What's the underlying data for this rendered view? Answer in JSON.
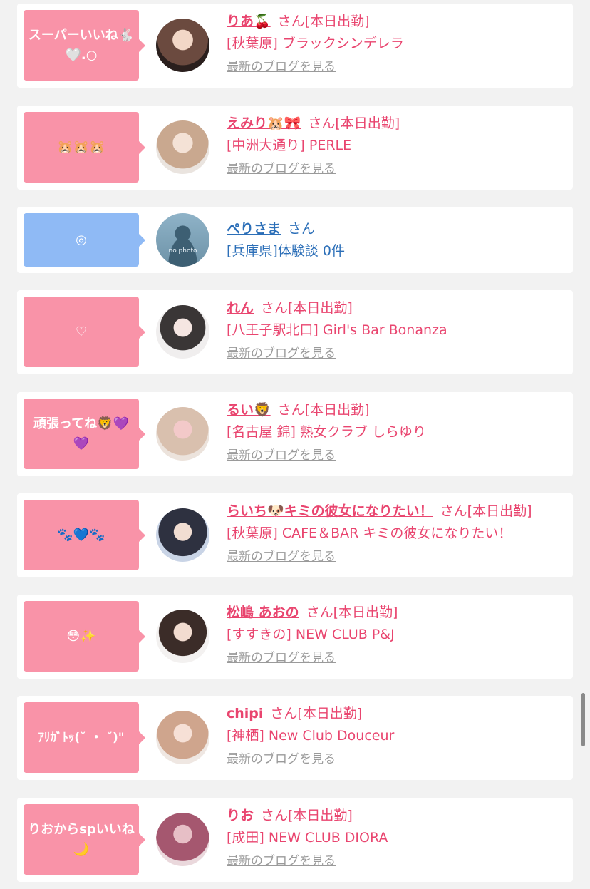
{
  "blog_link_label": "最新のブログを見る",
  "entries": [
    {
      "message": "スーパーいいね🐇🤍.○",
      "name": "りあ🍒",
      "suffix": "さん[本日出勤]",
      "shop": "[秋葉原] ブラックシンデレラ",
      "type": "pink",
      "avatar_color": "#6b4a3f"
    },
    {
      "message": "🐹🐹🐹",
      "name": "えみり🐹🎀",
      "suffix": "さん[本日出勤]",
      "shop": "[中洲大通り] PERLE",
      "type": "pink",
      "avatar_color": "#c9a88f"
    },
    {
      "message": "◎",
      "name": "ぺりさま",
      "suffix": "さん",
      "shop": "[兵庫県]体験談 0件",
      "type": "blue",
      "avatar_text": "no photo"
    },
    {
      "message": "♡",
      "name": "れん",
      "suffix": "さん[本日出勤]",
      "shop": "[八王子駅北口] Girl's Bar Bonanza",
      "type": "pink",
      "avatar_color": "#3a3636"
    },
    {
      "message": "頑張ってね🦁💜💜",
      "name": "るい🦁",
      "suffix": "さん[本日出勤]",
      "shop": "[名古屋 錦] 熟女クラブ しらゆり",
      "type": "pink",
      "avatar_color": "#d9c0ae"
    },
    {
      "message": "🐾💙🐾",
      "name": "らいち🐶キミの彼女になりたい！",
      "suffix": "さん[本日出勤]",
      "shop": "[秋葉原] CAFE＆BAR キミの彼女になりたい！",
      "type": "pink",
      "avatar_color": "#2e3140"
    },
    {
      "message": "😳✨",
      "name": "松嶋 あおの",
      "suffix": "さん[本日出勤]",
      "shop": "[すすきの] NEW CLUB P&J",
      "type": "pink",
      "avatar_color": "#3b2c28"
    },
    {
      "message": "ｱﾘｶﾞﾄｯ(˘ ・ ˘)\"",
      "name": "chipi",
      "suffix": "さん[本日出勤]",
      "shop": "[神栖] New Club Douceur",
      "type": "pink",
      "avatar_color": "#cfa58d"
    },
    {
      "message": "りおからspいいね🌙",
      "name": "りお",
      "suffix": "さん[本日出勤]",
      "shop": "[成田] NEW CLUB DIORA",
      "type": "pink",
      "avatar_color": "#a5576f"
    }
  ]
}
